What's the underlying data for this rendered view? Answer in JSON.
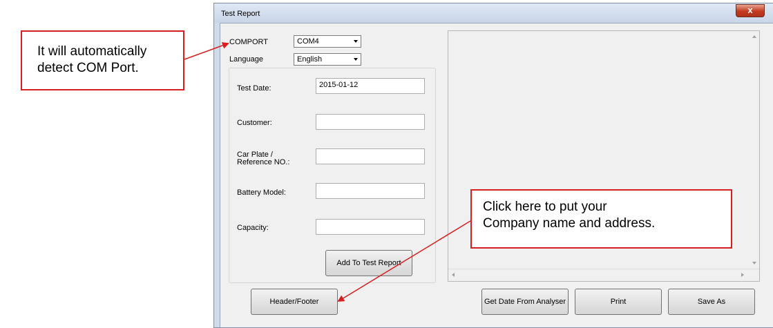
{
  "window": {
    "title": "Test Report",
    "close_glyph": "x"
  },
  "settings": {
    "comport_label": "COMPORT",
    "comport_value": "COM4",
    "language_label": "Language",
    "language_value": "English"
  },
  "form": {
    "test_date_label": "Test Date:",
    "test_date_value": "2015-01-12",
    "customer_label": "Customer:",
    "customer_value": "",
    "car_plate_label_line1": "Car Plate /",
    "car_plate_label_line2": "Reference NO.:",
    "car_plate_value": "",
    "battery_model_label": "Battery Model:",
    "battery_model_value": "",
    "capacity_label": "Capacity:",
    "capacity_value": "",
    "add_button": "Add To Test Report"
  },
  "buttons": {
    "header_footer": "Header/Footer",
    "get_date": "Get Date From Analyser",
    "print": "Print",
    "save_as": "Save As"
  },
  "callouts": {
    "comport_line1": "It will automatically",
    "comport_line2": "detect COM Port.",
    "header_line1": "Click here to put your",
    "header_line2": "Company name and address."
  },
  "colors": {
    "callout_border": "#d81f1f",
    "close_button": "#c3391f"
  }
}
